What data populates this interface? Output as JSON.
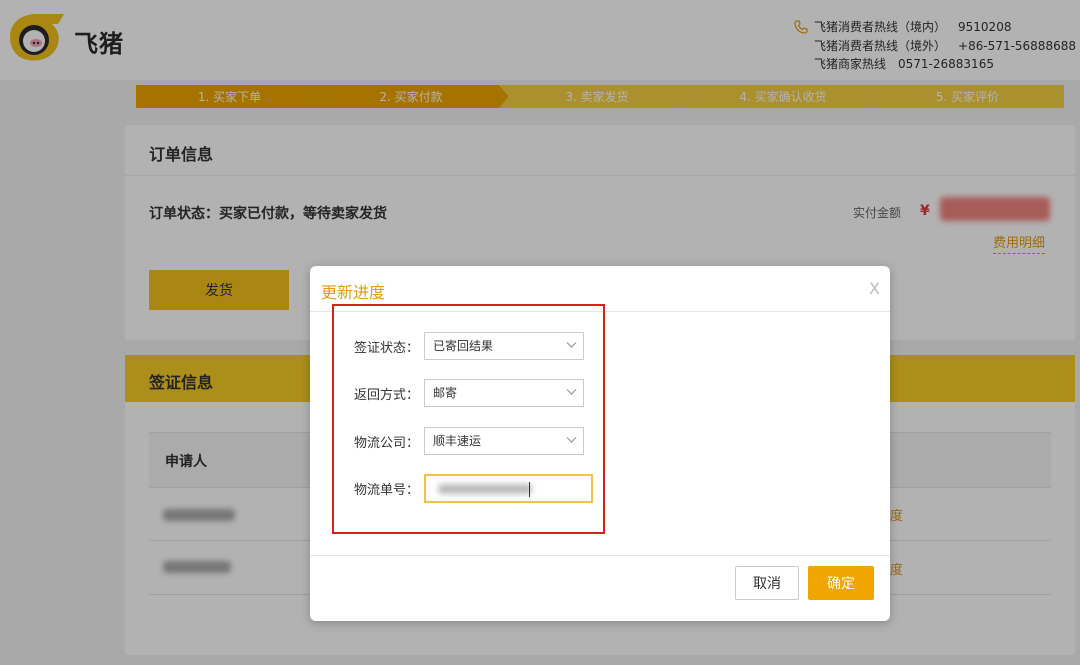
{
  "header": {
    "logo_text": "飞猪",
    "hotline": [
      {
        "label": "飞猪消费者热线（境内）",
        "number": "9510208"
      },
      {
        "label": "飞猪消费者热线（境外）",
        "number": "+86-571-56888688"
      },
      {
        "label": "飞猪商家热线",
        "number": "0571-26883165"
      }
    ]
  },
  "steps": [
    {
      "label": "1. 买家下单",
      "state": "done"
    },
    {
      "label": "2. 买家付款",
      "state": "done"
    },
    {
      "label": "3. 卖家发货",
      "state": "todo"
    },
    {
      "label": "4. 买家确认收货",
      "state": "todo"
    },
    {
      "label": "5. 买家评价",
      "state": "todo"
    }
  ],
  "order": {
    "title": "订单信息",
    "status": "订单状态：买家已付款，等待卖家发货",
    "pay_label": "实付金额",
    "currency": "¥",
    "fee_detail": "费用明细",
    "ship_button": "发货"
  },
  "visa": {
    "title": "签证信息",
    "col_applicant": "申请人",
    "rows": [
      {
        "action": "度"
      },
      {
        "action": "度"
      }
    ]
  },
  "modal": {
    "title": "更新进度",
    "close": "X",
    "fields": [
      {
        "label": "签证状态：",
        "value": "已寄回结果"
      },
      {
        "label": "返回方式：",
        "value": "邮寄"
      },
      {
        "label": "物流公司：",
        "value": "顺丰速运"
      },
      {
        "label": "物流单号：",
        "value": ""
      }
    ],
    "cancel": "取消",
    "confirm": "确定"
  },
  "colors": {
    "accent_orange": "#f0a500",
    "step_done": "#f0a500",
    "step_todo": "#f5cf45",
    "visa_header": "#f6cc28",
    "highlight_box": "#d9201c"
  }
}
